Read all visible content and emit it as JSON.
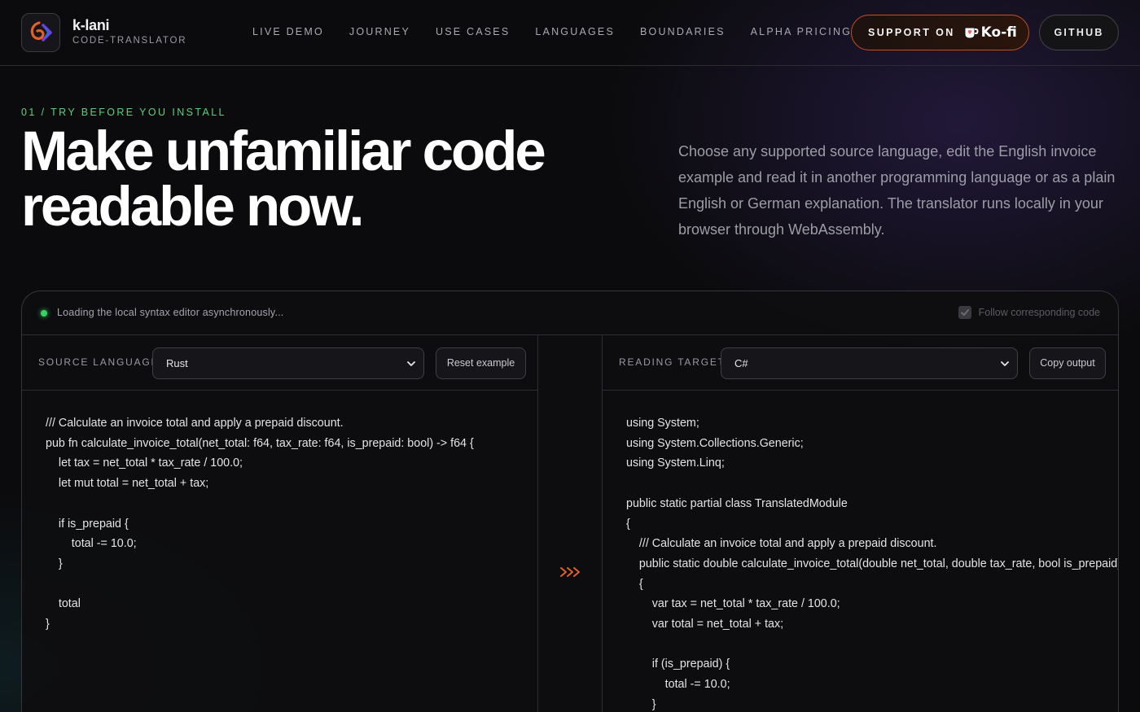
{
  "brand": {
    "name": "k-lani",
    "subtitle": "CODE-TRANSLATOR"
  },
  "nav": {
    "items": [
      "LIVE DEMO",
      "JOURNEY",
      "USE CASES",
      "LANGUAGES",
      "BOUNDARIES",
      "ALPHA PRICING"
    ]
  },
  "header_buttons": {
    "support_label": "SUPPORT ON",
    "support_brand": "Ko-fi",
    "github_label": "GITHUB"
  },
  "hero": {
    "eyebrow": "01 / TRY BEFORE YOU INSTALL",
    "title_line1": "Make unfamiliar code",
    "title_line2": "readable now.",
    "description": "Choose any supported source language, edit the English invoice example and read it in another programming language or as a plain English or German explanation. The translator runs locally in your browser through WebAssembly."
  },
  "translator": {
    "status": "Loading the local syntax editor asynchronously...",
    "follow_label": "Follow corresponding code",
    "follow_checked": true,
    "source": {
      "label": "SOURCE LANGUAGE",
      "selected": "Rust",
      "reset_label": "Reset example",
      "code": "/// Calculate an invoice total and apply a prepaid discount.\npub fn calculate_invoice_total(net_total: f64, tax_rate: f64, is_prepaid: bool) -> f64 {\n    let tax = net_total * tax_rate / 100.0;\n    let mut total = net_total + tax;\n\n    if is_prepaid {\n        total -= 10.0;\n    }\n\n    total\n}"
    },
    "target": {
      "label": "READING TARGET",
      "selected": "C#",
      "copy_label": "Copy output",
      "code": "using System;\nusing System.Collections.Generic;\nusing System.Linq;\n\npublic static partial class TranslatedModule\n{\n    /// Calculate an invoice total and apply a prepaid discount.\n    public static double calculate_invoice_total(double net_total, double tax_rate, bool is_prepaid)\n    {\n        var tax = net_total * tax_rate / 100.0;\n        var total = net_total + tax;\n\n        if (is_prepaid) {\n            total -= 10.0;\n        }"
    },
    "arrow_icon": "triple-chevron-right-icon",
    "accent_color": "#e2612a",
    "status_color": "#3ccf63"
  }
}
